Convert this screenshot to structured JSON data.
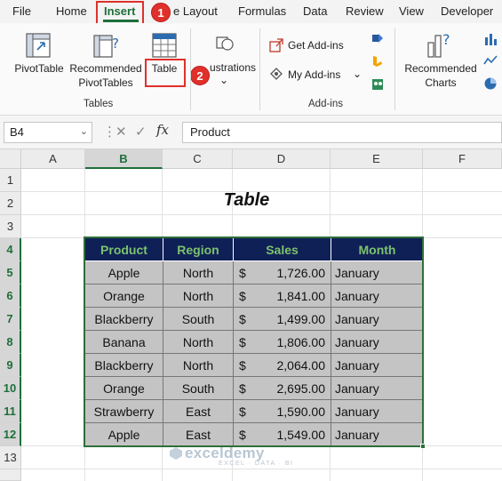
{
  "menu": {
    "items": [
      "File",
      "Home",
      "Insert",
      "e Layout",
      "Formulas",
      "Data",
      "Review",
      "View",
      "Developer"
    ],
    "active": "Insert"
  },
  "annotations": {
    "step1": "1",
    "step2": "2"
  },
  "ribbon": {
    "pivot_table": "PivotTable",
    "rec_pivot_1": "Recommended",
    "rec_pivot_2": "PivotTables",
    "table": "Table",
    "illustrations": "ustrations",
    "group_tables": "Tables",
    "get_addins": "Get Add-ins",
    "my_addins": "My Add-ins",
    "group_addins": "Add-ins",
    "rec_charts_1": "Recommended",
    "rec_charts_2": "Charts"
  },
  "formula_bar": {
    "name_box": "B4",
    "formula": "Product"
  },
  "columns": [
    "A",
    "B",
    "C",
    "D",
    "E",
    "F"
  ],
  "rows": [
    "1",
    "2",
    "3",
    "4",
    "5",
    "6",
    "7",
    "8",
    "9",
    "10",
    "11",
    "12",
    "13"
  ],
  "sheet": {
    "title": "Table",
    "headers": [
      "Product",
      "Region",
      "Sales",
      "Month"
    ],
    "currency": "$",
    "data": [
      [
        "Apple",
        "North",
        "1,726.00",
        "January"
      ],
      [
        "Orange",
        "North",
        "1,841.00",
        "January"
      ],
      [
        "Blackberry",
        "South",
        "1,499.00",
        "January"
      ],
      [
        "Banana",
        "North",
        "1,806.00",
        "January"
      ],
      [
        "Blackberry",
        "North",
        "2,064.00",
        "January"
      ],
      [
        "Orange",
        "South",
        "2,695.00",
        "January"
      ],
      [
        "Strawberry",
        "East",
        "1,590.00",
        "January"
      ],
      [
        "Apple",
        "East",
        "1,549.00",
        "January"
      ]
    ]
  },
  "watermark": {
    "name": "exceldemy",
    "tagline": "EXCEL · DATA · BI"
  },
  "colors": {
    "accent": "#1e6f3a",
    "highlight": "#e0302b",
    "table_header_bg": "#0f2057",
    "table_header_text": "#7cc26c",
    "table_body_bg": "#c4c4c4"
  }
}
